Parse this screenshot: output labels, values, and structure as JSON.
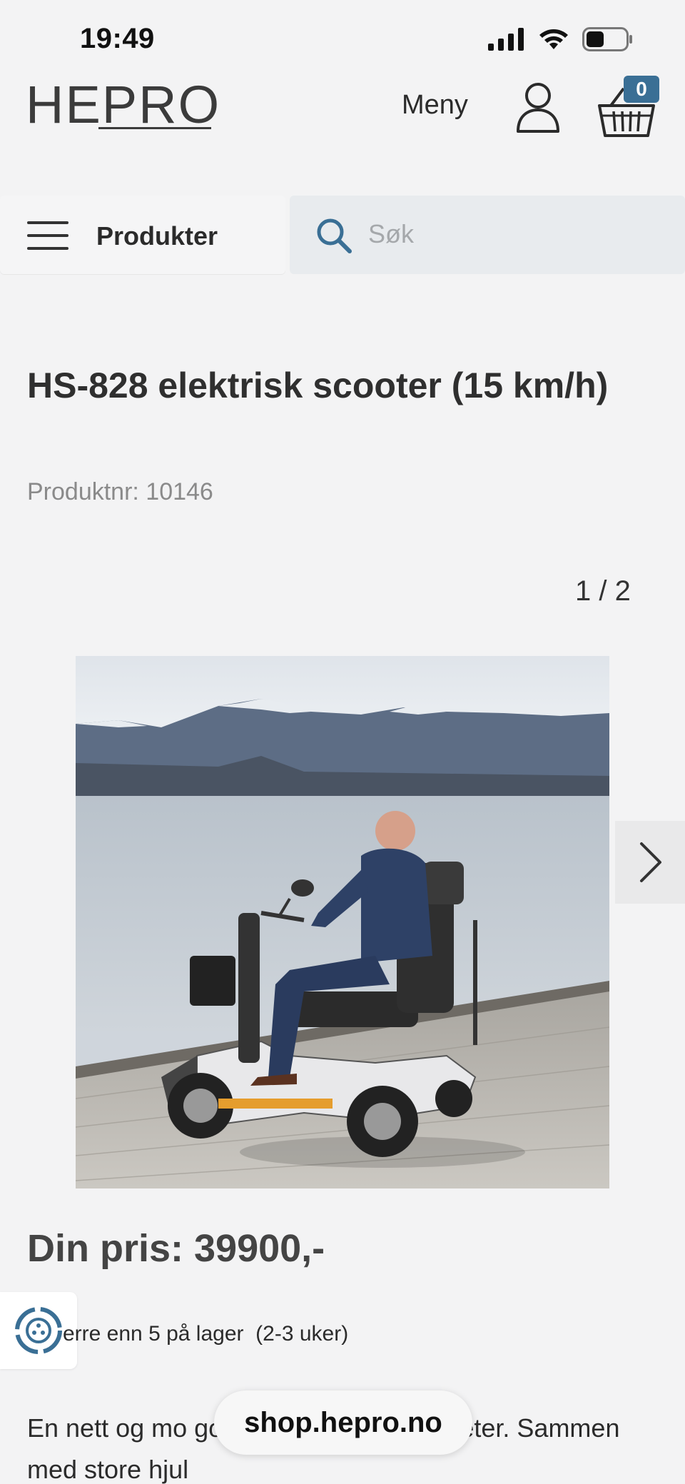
{
  "status_bar": {
    "time": "19:49"
  },
  "header": {
    "logo": "HEPRO",
    "menu_label": "Meny",
    "cart_count": "0"
  },
  "nav": {
    "products_label": "Produkter",
    "search_placeholder": "Søk"
  },
  "product": {
    "title": "HS-828 elektrisk scooter (15 km/h)",
    "number_text": "Produktnr: 10146",
    "image_counter": "1 / 2",
    "price_text": "Din pris: 39900,-",
    "stock_text": "erre enn 5 på lager  (2-3 uker)",
    "description": "En nett og mo  gode innstillings muligheter. Sammen med store hjul"
  },
  "browser": {
    "url": "shop.hepro.no"
  },
  "colors": {
    "accent": "#3a6f95",
    "background": "#f3f3f4",
    "search_bg": "#e8ebee"
  }
}
